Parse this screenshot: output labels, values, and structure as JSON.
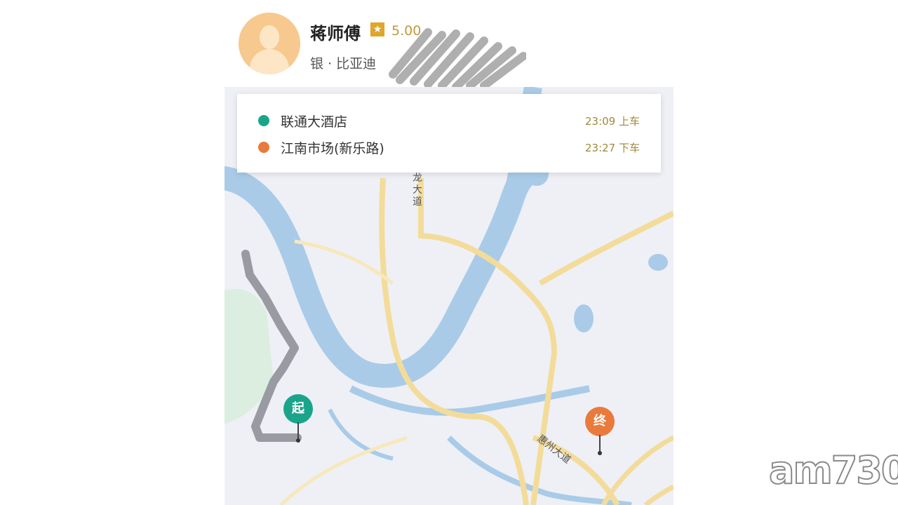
{
  "driver": {
    "name": "蒋师傅",
    "rating": "5.00",
    "car": "银 · 比亚迪"
  },
  "trip": {
    "origin": {
      "name": "联通大酒店",
      "time": "23:09 上车",
      "color": "#1aa58b"
    },
    "destination": {
      "name": "江南市场(新乐路)",
      "time": "23:27 下车",
      "color": "#ea7a3c"
    }
  },
  "map": {
    "start_pin_label": "起",
    "end_pin_label": "终",
    "road_labels": {
      "north_road": "龙大道",
      "south_road": "惠州大道"
    },
    "colors": {
      "water": "#a9cbe8",
      "road": "#f3dc9a",
      "route": "#9a9aa2",
      "land": "#eef0f6"
    }
  },
  "watermark": "am730"
}
